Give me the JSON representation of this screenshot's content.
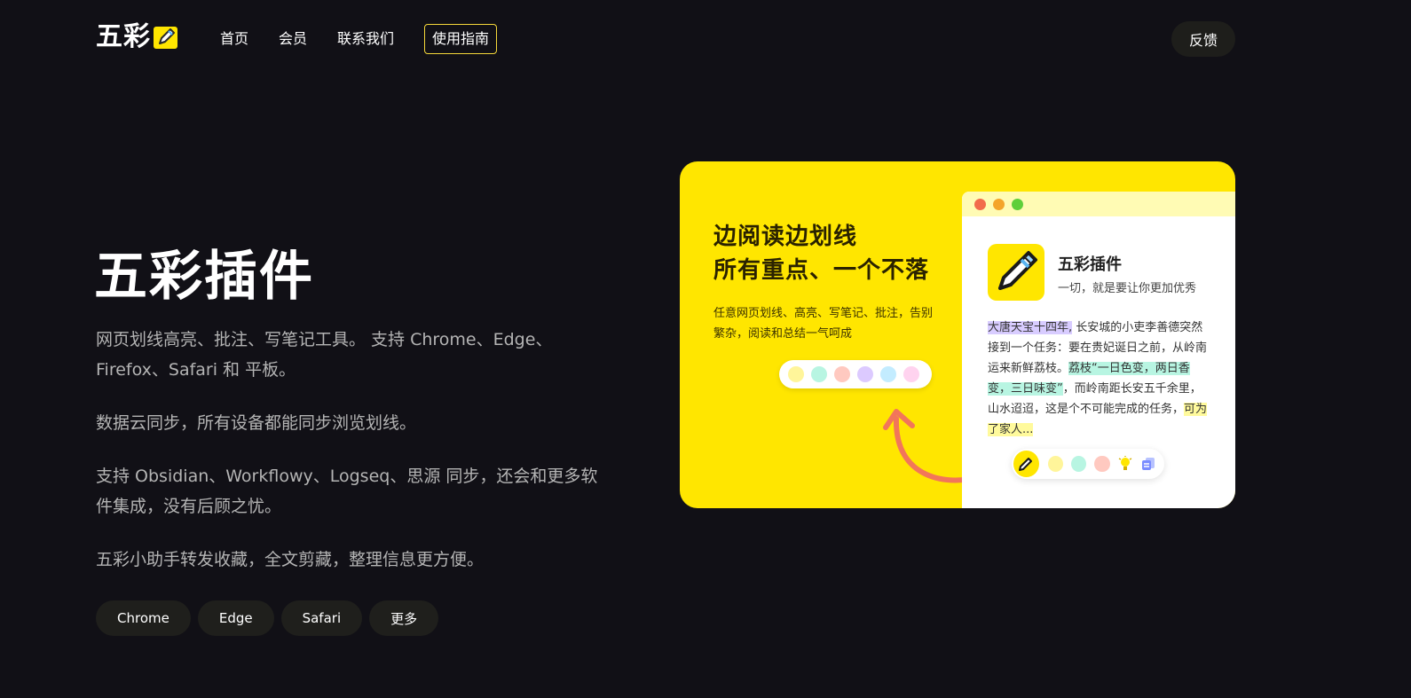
{
  "header": {
    "logo_text": "五彩",
    "nav": [
      {
        "label": "首页"
      },
      {
        "label": "会员"
      },
      {
        "label": "联系我们"
      },
      {
        "label": "使用指南"
      }
    ],
    "feedback_label": "反馈"
  },
  "hero": {
    "title": "五彩插件",
    "paragraphs": [
      "网页划线高亮、批注、写笔记工具。 支持 Chrome、Edge、Firefox、Safari 和 平板。",
      "数据云同步，所有设备都能同步浏览划线。",
      "支持 Obsidian、Workflowy、Logseq、思源 同步，还会和更多软件集成，没有后顾之忧。",
      "五彩小助手转发收藏，全文剪藏，整理信息更方便。"
    ],
    "browser_tags": [
      {
        "label": "Chrome"
      },
      {
        "label": "Edge"
      },
      {
        "label": "Safari"
      },
      {
        "label": "更多"
      }
    ]
  },
  "promo": {
    "headline_line1": "边阅读边划线",
    "headline_line2": "所有重点、一个不落",
    "subtext": "任意网页划线、高亮、写笔记、批注，告别繁杂，阅读和总结一气呵成",
    "palette_colors": [
      "#fff59a",
      "#b8f5e2",
      "#ffc9c0",
      "#dccaff",
      "#c3ecff",
      "#ffd3ef"
    ],
    "window": {
      "traffic_colors": [
        "#f26b4b",
        "#f4a52a",
        "#5fcf3a"
      ],
      "app_name": "五彩插件",
      "app_slogan": "一切，就是要让你更加优秀",
      "story_hl1": "大唐天宝十四年,",
      "story_p1": " 长安城的小吏李善德突然接到一个任务：要在贵妃诞日之前，从岭南运来新鲜荔枝。",
      "story_hl2": "荔枝“一日色变，两日香变，三日味变”",
      "story_p2": "，而岭南距长安五千余里，山水迢迢，这是个不可能完成的任务，",
      "story_hl3": "可为了家人...",
      "toolbar_colors": [
        "#fff59a",
        "#b8f5e2",
        "#ffc9c0"
      ]
    }
  },
  "colors": {
    "background": "#111016",
    "accent_yellow": "#ffe600",
    "arrow": "#f2765a",
    "guide_border": "#f5d83a"
  }
}
